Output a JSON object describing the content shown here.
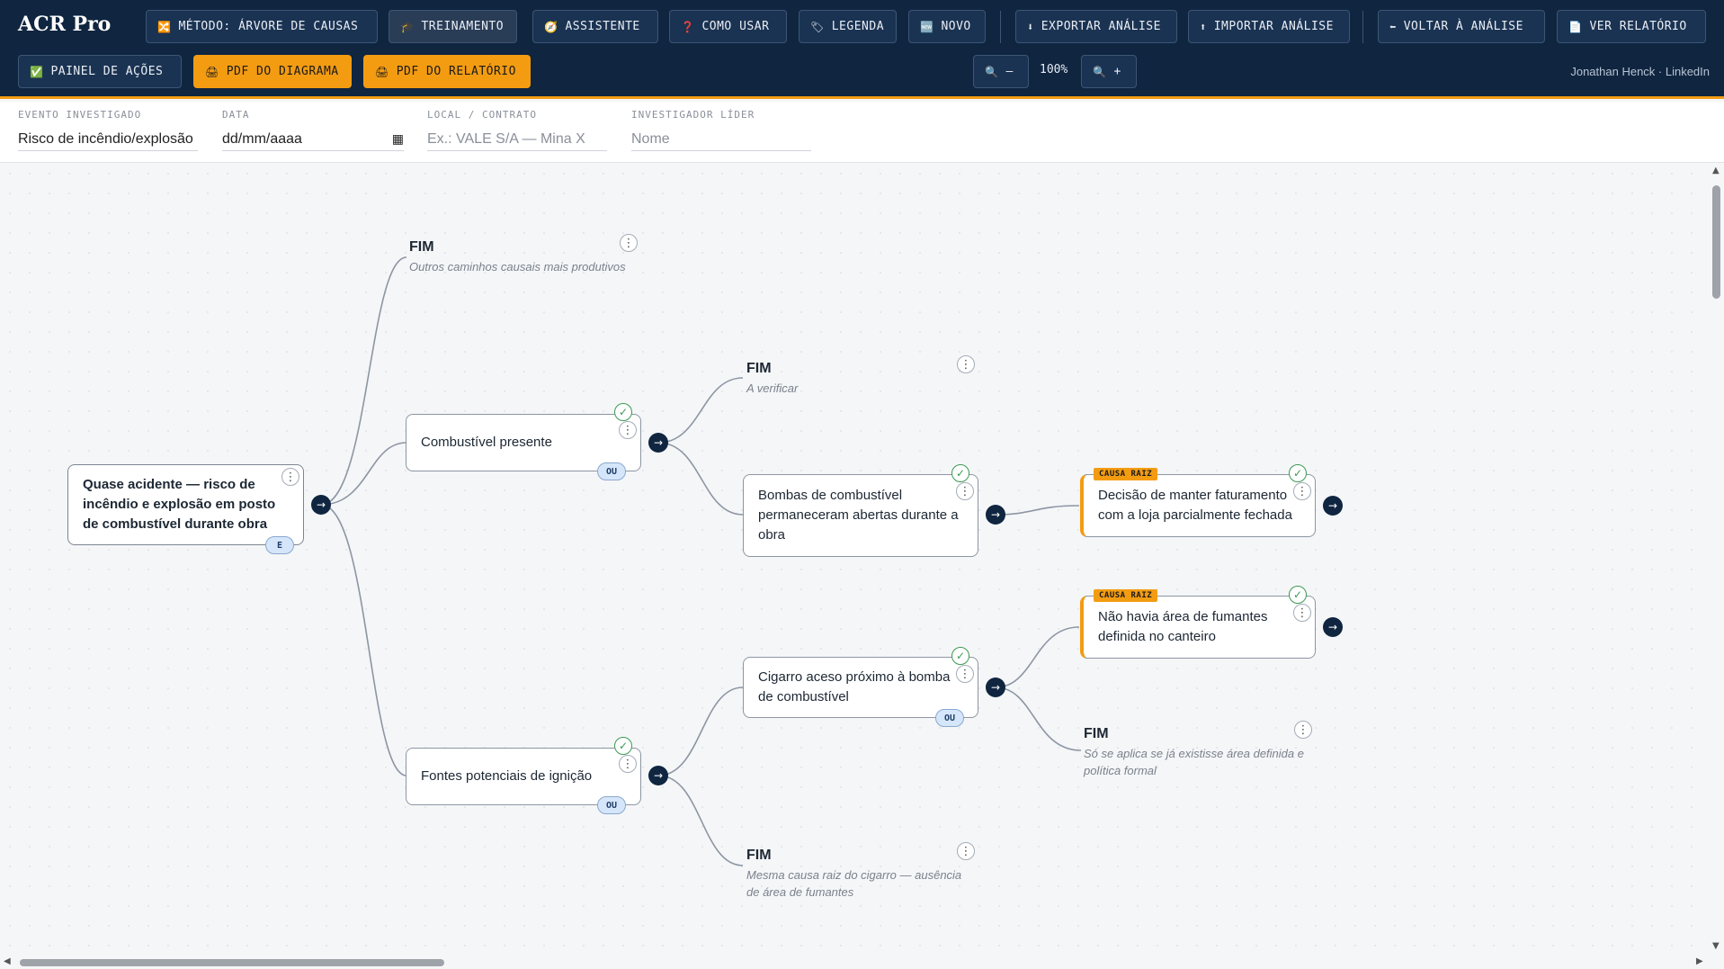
{
  "app": {
    "title": "ACR Pro",
    "credit": "Jonathan Henck · LinkedIn"
  },
  "toolbar": {
    "row1": [
      {
        "icon": "🔀",
        "label": "MÉTODO: ÁRVORE DE CAUSAS"
      },
      {
        "icon": "🎓",
        "label": "TREINAMENTO"
      },
      {
        "icon": "🧭",
        "label": "ASSISTENTE"
      },
      {
        "icon": "❓",
        "label": "COMO USAR"
      },
      {
        "icon": "🏷",
        "label": "LEGENDA"
      },
      {
        "icon": "🆕",
        "label": "NOVO"
      },
      {
        "icon": "⬇",
        "label": "EXPORTAR ANÁLISE"
      },
      {
        "icon": "⬆",
        "label": "IMPORTAR ANÁLISE"
      },
      {
        "icon": "⬅",
        "label": "VOLTAR À ANÁLISE"
      },
      {
        "icon": "📄",
        "label": "VER RELATÓRIO"
      }
    ],
    "row2": [
      {
        "icon": "✅",
        "label": "PAINEL DE AÇÕES"
      },
      {
        "icon": "🖨",
        "label": "PDF DO DIAGRAMA"
      },
      {
        "icon": "🖨",
        "label": "PDF DO RELATÓRIO"
      }
    ],
    "zoom_out": {
      "icon": "🔍",
      "label": "–"
    },
    "zoom_value": "100%",
    "zoom_in": {
      "icon": "🔍",
      "label": "+"
    }
  },
  "form": {
    "event": {
      "label": "EVENTO INVESTIGADO",
      "value": "Risco de incêndio/explosão"
    },
    "date": {
      "label": "DATA",
      "value": "dd/mm/aaaa"
    },
    "location": {
      "label": "LOCAL / CONTRATO",
      "placeholder": "Ex.: VALE S/A — Mina X"
    },
    "lead": {
      "label": "INVESTIGADOR LÍDER",
      "placeholder": "Nome"
    }
  },
  "tree": {
    "root": {
      "text": "Quase acidente — risco de incêndio e explosão em posto de combustível durante obra",
      "gate": "E"
    },
    "fuel": {
      "text": "Combustível presente",
      "gate": "OU"
    },
    "ignition": {
      "text": "Fontes potenciais de ignição",
      "gate": "OU"
    },
    "pumps": {
      "text": "Bombas de combustível permaneceram abertas durante a obra"
    },
    "cigarette": {
      "text": "Cigarro aceso próximo à bomba de combustível",
      "gate": "OU"
    },
    "rc_revenue": {
      "tag": "CAUSA RAIZ",
      "text": "Decisão de manter faturamento com a loja parcialmente fechada"
    },
    "rc_smoking": {
      "tag": "CAUSA RAIZ",
      "text": "Não havia área de fumantes definida no canteiro"
    },
    "fim1": {
      "title": "FIM",
      "desc": "Outros caminhos causais mais produtivos"
    },
    "fim2": {
      "title": "FIM",
      "desc": "A verificar"
    },
    "fim3": {
      "title": "FIM",
      "desc": "Só se aplica se já existisse área definida e política formal"
    },
    "fim4": {
      "title": "FIM",
      "desc": "Mesma causa raiz do cigarro — ausência de área de fumantes"
    }
  },
  "colors": {
    "header": "#0f2540",
    "accent": "#f39c12",
    "check": "#3b9a52",
    "gate": "#d6e6fa"
  }
}
